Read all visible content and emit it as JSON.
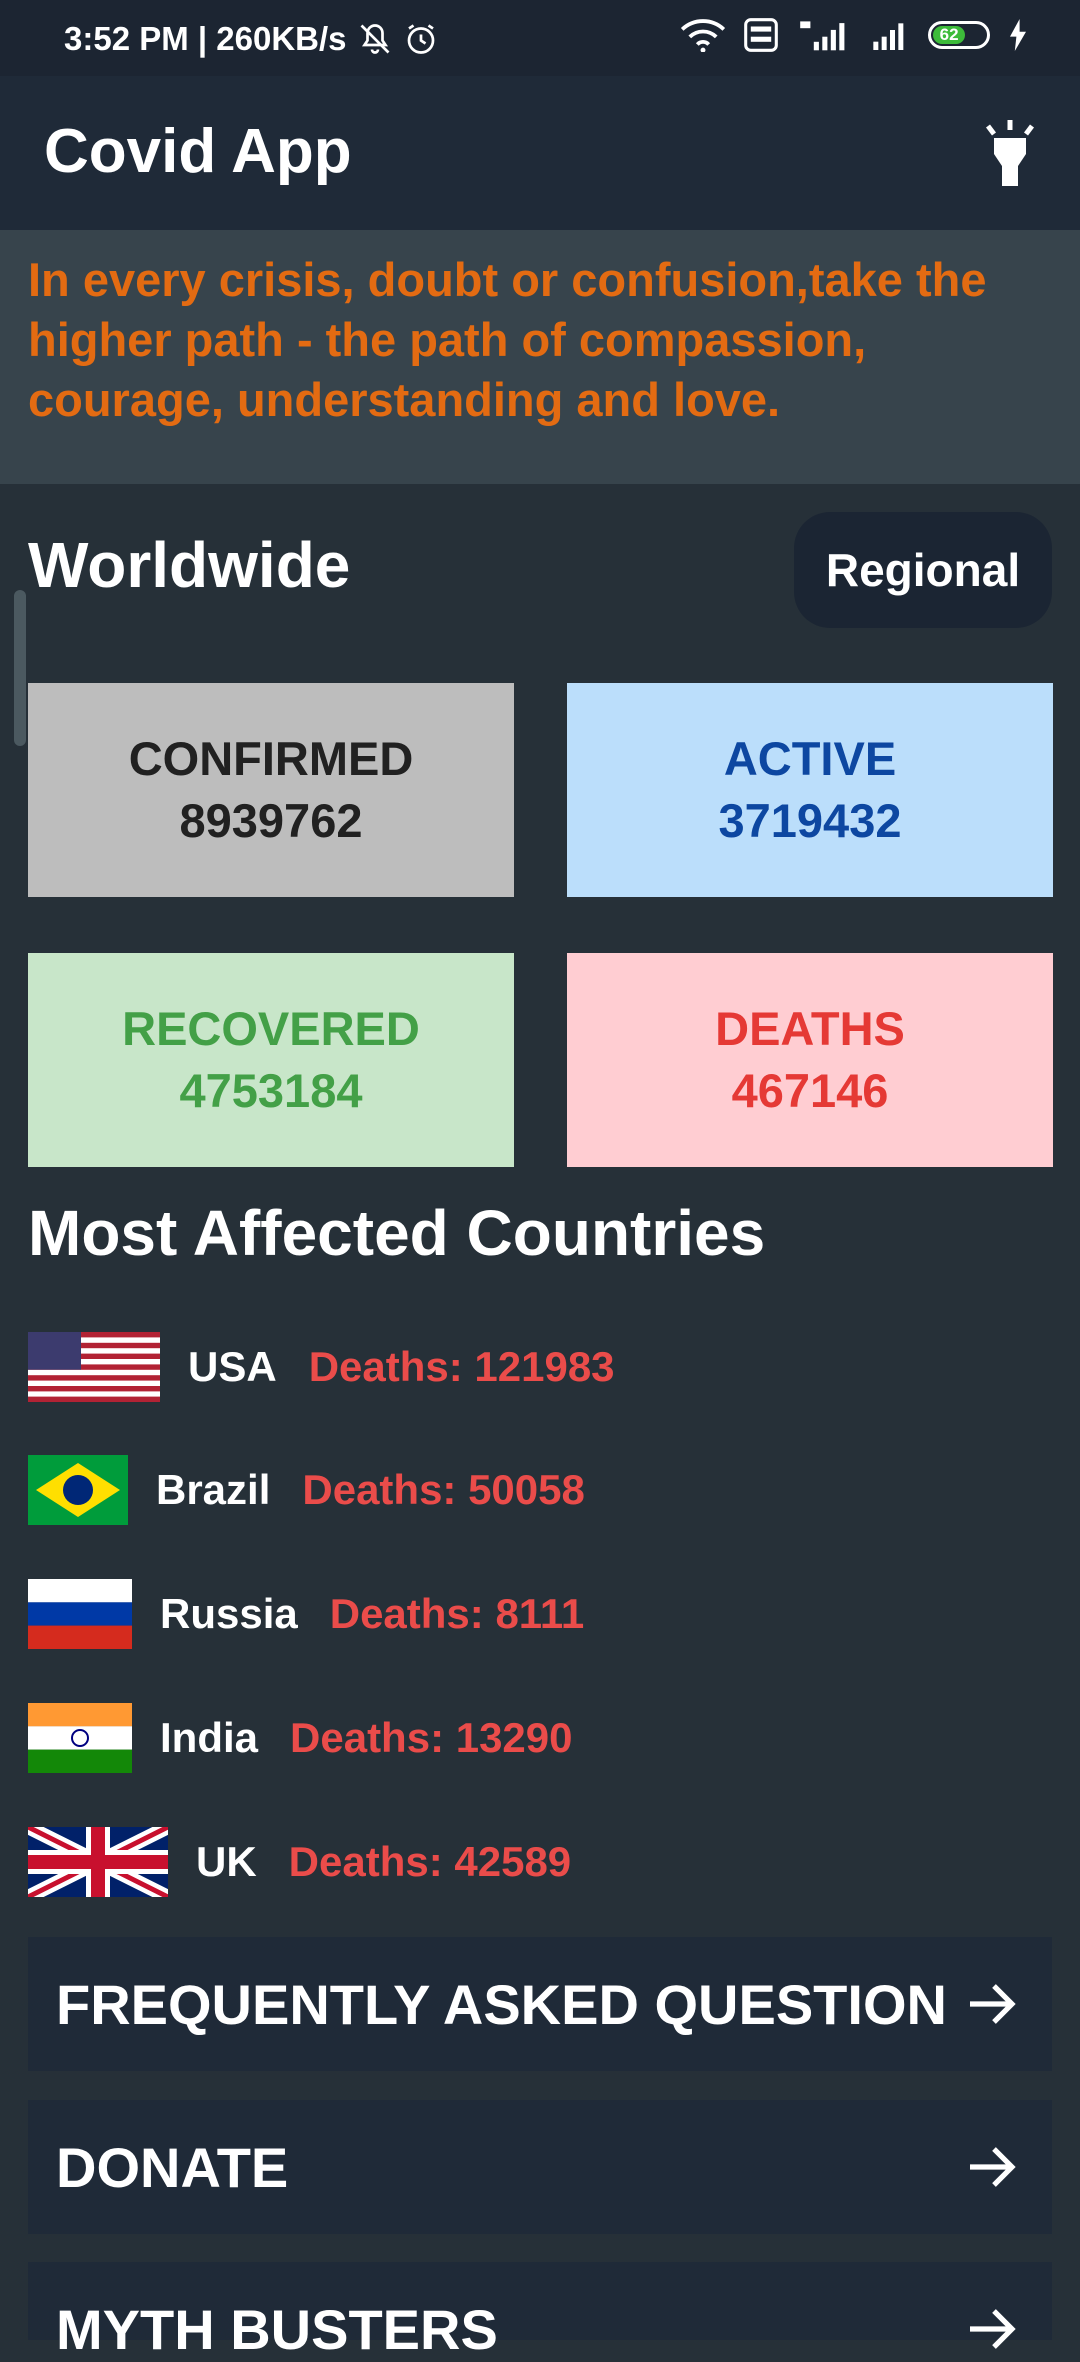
{
  "status_bar": {
    "time": "3:52 PM | 260KB/s",
    "battery": "62"
  },
  "app_bar": {
    "title": "Covid App"
  },
  "quote": {
    "text": "In every crisis, doubt or confusion,take the higher path - the path of compassion, courage, understanding and love."
  },
  "worldwide": {
    "title": "Worldwide",
    "regional_button": "Regional"
  },
  "stats": [
    {
      "label": "CONFIRMED",
      "value": "8939762",
      "bg": "#bdbdbd",
      "color": "#212121"
    },
    {
      "label": "ACTIVE",
      "value": "3719432",
      "bg": "#bbdefb",
      "color": "#0d47a1"
    },
    {
      "label": "RECOVERED",
      "value": "4753184",
      "bg": "#c8e6c9",
      "color": "#43a047"
    },
    {
      "label": "DEATHS",
      "value": "467146",
      "bg": "#ffcdd2",
      "color": "#e53935"
    }
  ],
  "most_affected": {
    "title": "Most Affected Countries",
    "countries": [
      {
        "name": "USA",
        "deaths": "Deaths: 121983"
      },
      {
        "name": "Brazil",
        "deaths": "Deaths: 50058"
      },
      {
        "name": "Russia",
        "deaths": "Deaths: 8111"
      },
      {
        "name": "India",
        "deaths": "Deaths: 13290"
      },
      {
        "name": "UK",
        "deaths": "Deaths: 42589"
      }
    ]
  },
  "nav": [
    {
      "label": "FREQUENTLY ASKED QUESTION"
    },
    {
      "label": "DONATE"
    },
    {
      "label": "MYTH BUSTERS"
    }
  ],
  "colors": {
    "background": "#263038",
    "app_bar": "#1f2a38",
    "quote": "#e36b12",
    "deaths_text": "#ea4c4a"
  },
  "icons": {
    "torch": "flashlight-icon",
    "nav_arrow": "arrow-right-icon"
  }
}
